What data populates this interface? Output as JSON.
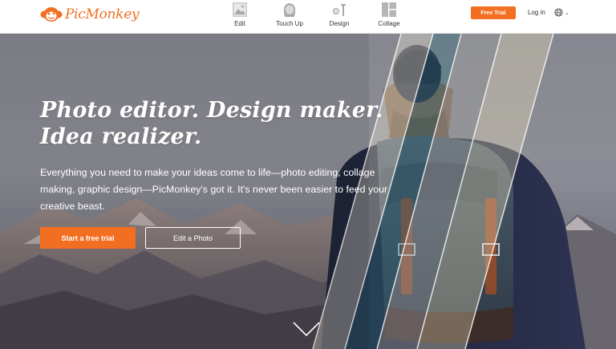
{
  "brand": {
    "name": "PicMonkey",
    "color": "#f26e21"
  },
  "nav": {
    "items": [
      {
        "label": "Edit",
        "icon": "image-icon"
      },
      {
        "label": "Touch Up",
        "icon": "face-icon"
      },
      {
        "label": "Design",
        "icon": "design-icon"
      },
      {
        "label": "Collage",
        "icon": "collage-icon"
      }
    ]
  },
  "header": {
    "free_trial_label": "Free Trial",
    "login_label": "Log in",
    "language_icon": "globe-icon"
  },
  "hero": {
    "headline_line1": "Photo editor. Design maker.",
    "headline_line2": "Idea realizer.",
    "subtext": "Everything you need to make your ideas come to life—photo editing, collage making, graphic design—PicMonkey's got it. It's never been easier to feed your creative beast.",
    "primary_cta": "Start a free trial",
    "secondary_cta": "Edit a Photo",
    "scroll_icon": "chevron-down-icon"
  },
  "colors": {
    "accent": "#f26e21",
    "text": "#333333",
    "hero_text": "#ffffff"
  }
}
